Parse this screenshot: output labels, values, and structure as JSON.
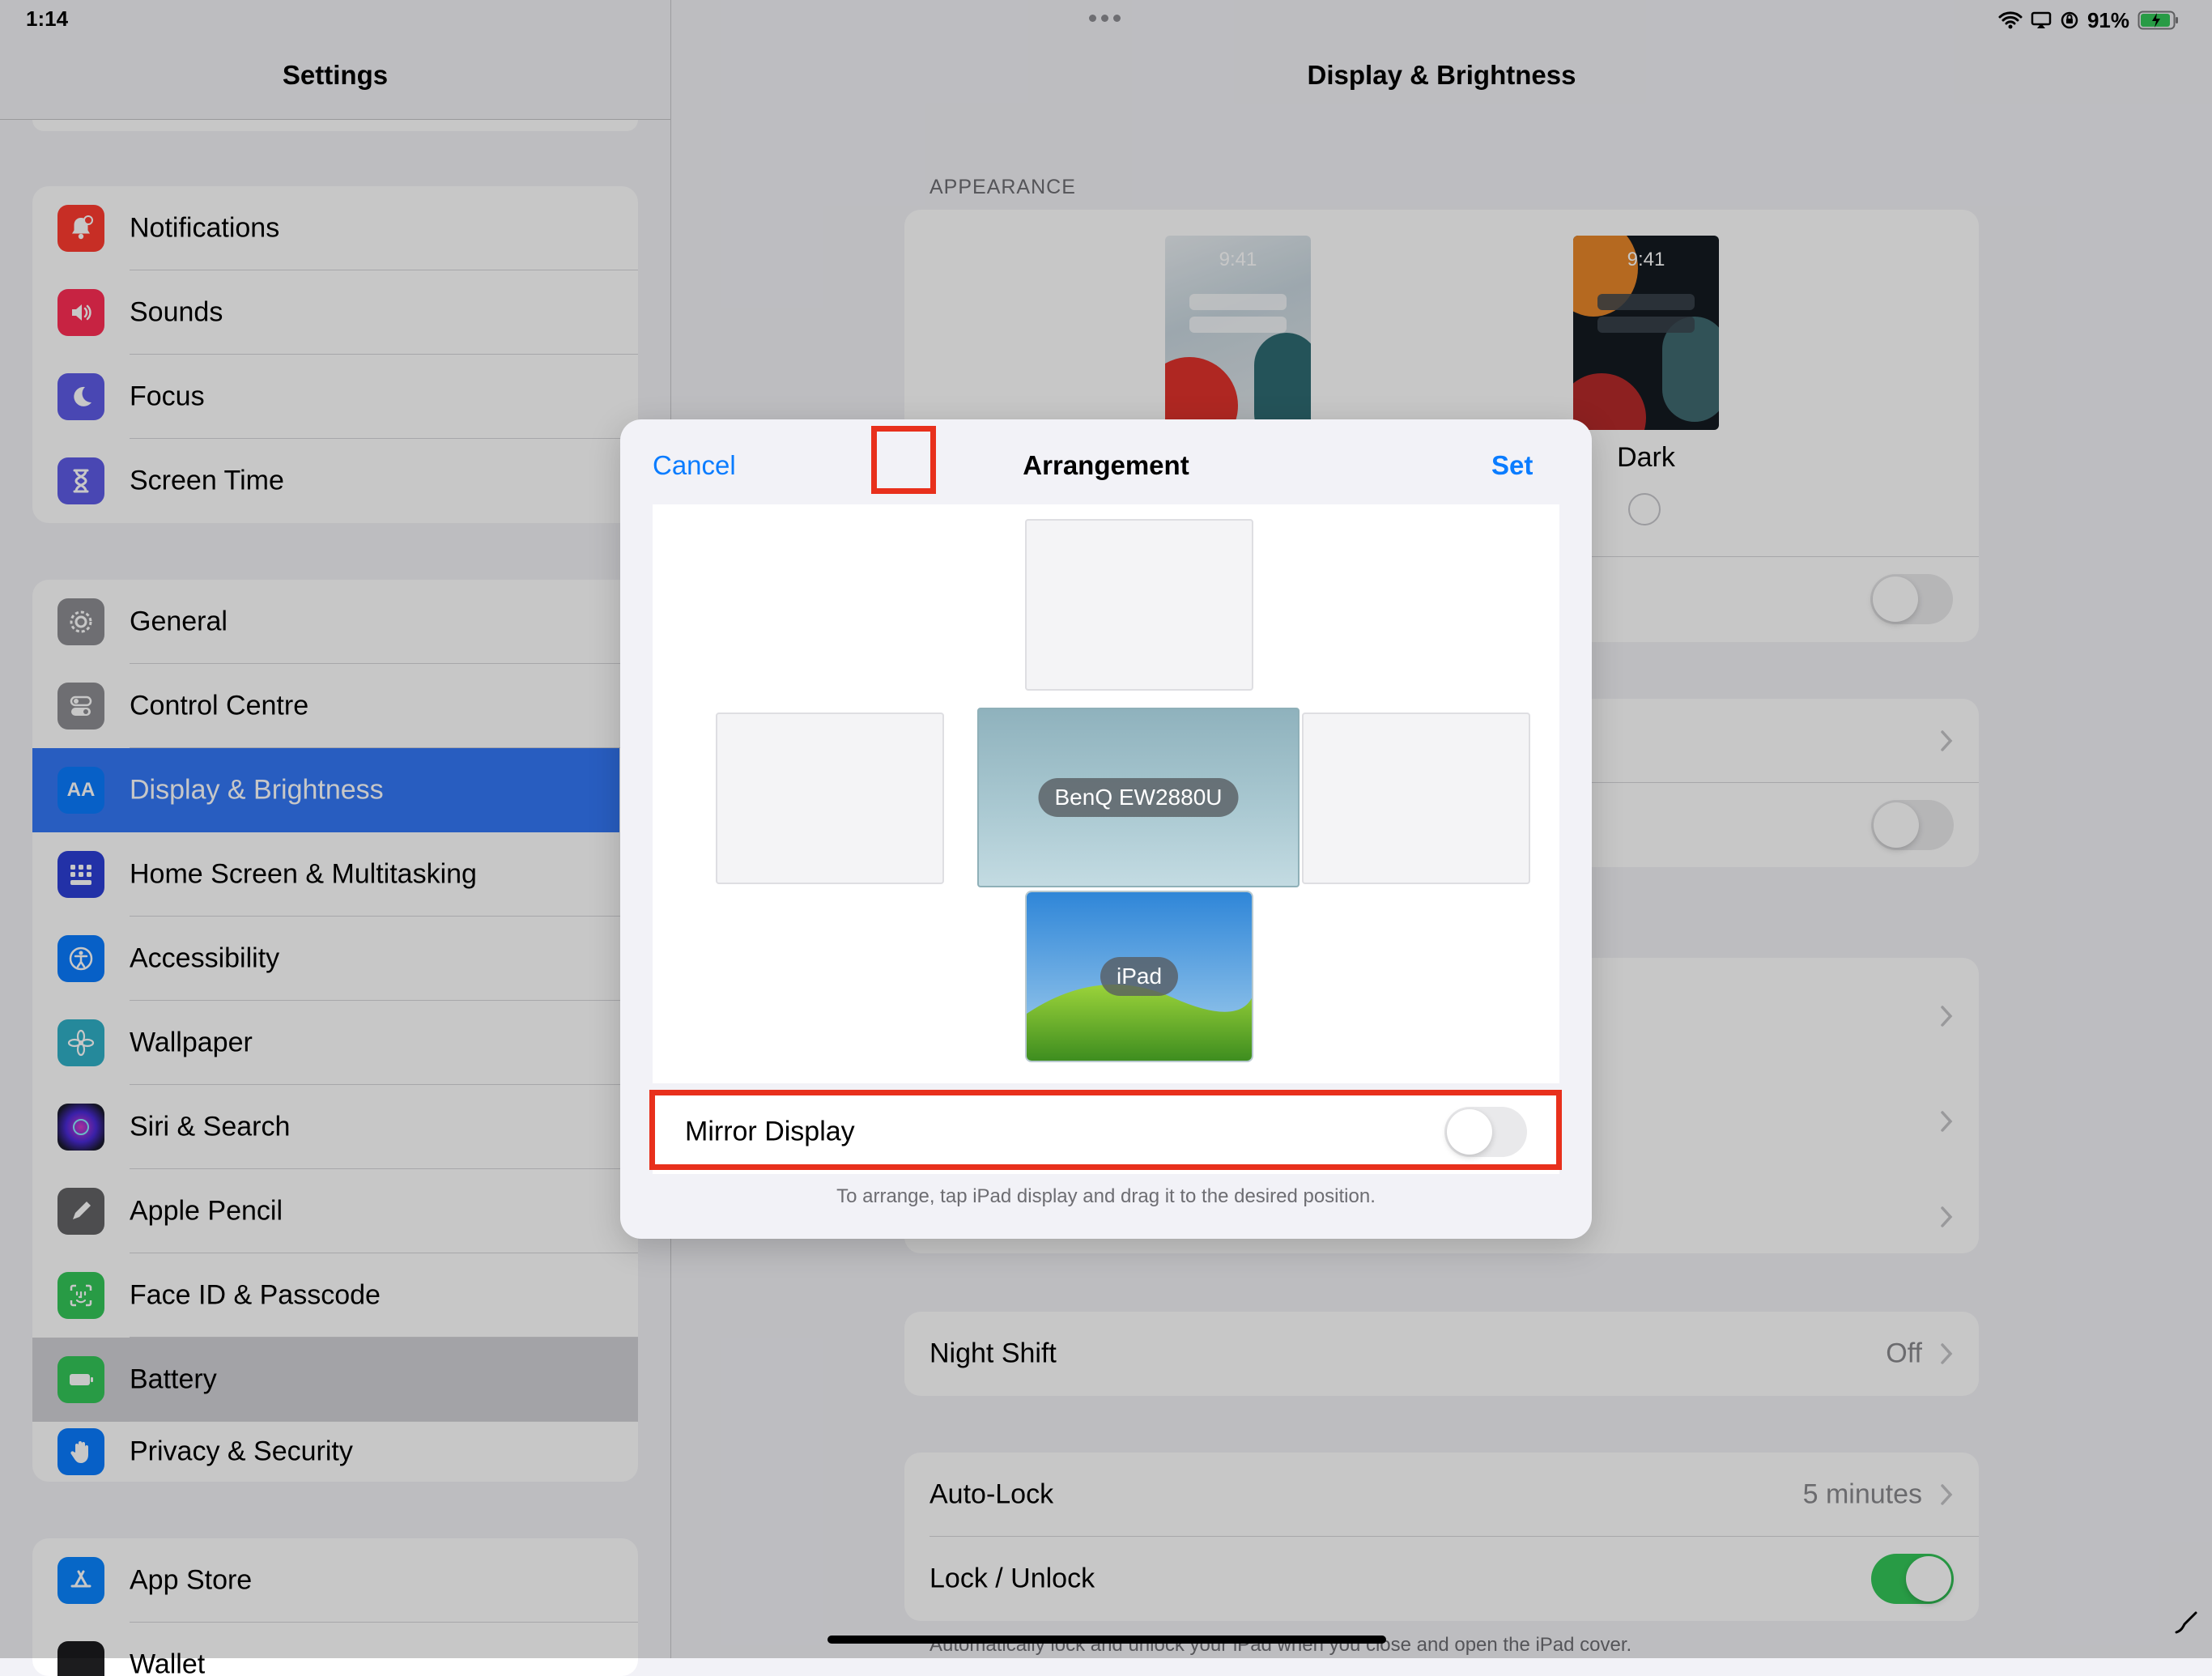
{
  "status_bar": {
    "time": "1:14",
    "battery": "91%"
  },
  "sidebar": {
    "title": "Settings",
    "groups": [
      {
        "items": [
          {
            "label": "Notifications"
          },
          {
            "label": "Sounds"
          },
          {
            "label": "Focus"
          },
          {
            "label": "Screen Time"
          }
        ]
      },
      {
        "items": [
          {
            "label": "General"
          },
          {
            "label": "Control Centre"
          },
          {
            "label": "Display & Brightness"
          },
          {
            "label": "Home Screen & Multitasking"
          },
          {
            "label": "Accessibility"
          },
          {
            "label": "Wallpaper"
          },
          {
            "label": "Siri & Search"
          },
          {
            "label": "Apple Pencil"
          },
          {
            "label": "Face ID & Passcode"
          },
          {
            "label": "Battery"
          },
          {
            "label": "Privacy & Security"
          }
        ]
      },
      {
        "items": [
          {
            "label": "App Store"
          },
          {
            "label": "Wallet"
          }
        ]
      }
    ],
    "selected": "Display & Brightness",
    "accent": "#3478f6"
  },
  "detail": {
    "title": "Display & Brightness",
    "appearance_header": "APPEARANCE",
    "light_thumb_time": "9:41",
    "dark_thumb_time": "9:41",
    "dark_label": "Dark",
    "night_shift": {
      "label": "Night Shift",
      "value": "Off"
    },
    "auto_lock": {
      "label": "Auto-Lock",
      "value": "5 minutes"
    },
    "lock_unlock": {
      "label": "Lock / Unlock",
      "on": true
    },
    "footnote": "Automatically lock and unlock your iPad when you close and open the iPad cover."
  },
  "modal": {
    "title": "Arrangement",
    "cancel_label": "Cancel",
    "set_label": "Set",
    "external_display": "BenQ EW2880U",
    "ipad_display": "iPad",
    "mirror_label": "Mirror Display",
    "mirror_on": false,
    "hint": "To arrange, tap iPad display and drag it to the desired position.",
    "highlight_color": "#e8301c"
  }
}
